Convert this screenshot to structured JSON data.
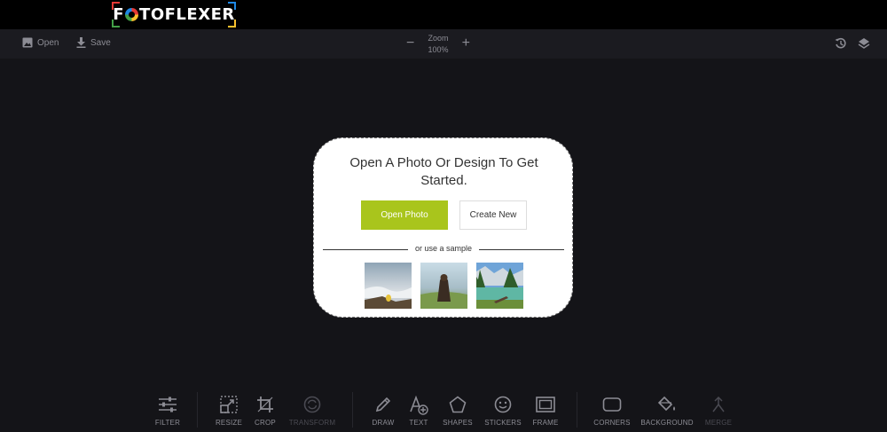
{
  "brand": {
    "name_prefix": "F",
    "name_suffix": "TOFLEXER"
  },
  "toolbar": {
    "open_label": "Open",
    "save_label": "Save",
    "zoom_label": "Zoom",
    "zoom_value": "100%",
    "zoom_minus": "−",
    "zoom_plus": "+"
  },
  "card": {
    "title": "Open A Photo Or Design To Get Started.",
    "open_photo_label": "Open Photo",
    "create_new_label": "Create New",
    "sample_label": "or use a sample",
    "samples": [
      "sample-fog-mountain",
      "sample-woman-hill",
      "sample-lake-forest"
    ]
  },
  "tools": [
    {
      "label": "FILTER",
      "icon": "sliders-icon",
      "enabled": true
    },
    {
      "label": "RESIZE",
      "icon": "resize-icon",
      "enabled": true
    },
    {
      "label": "CROP",
      "icon": "crop-icon",
      "enabled": true
    },
    {
      "label": "TRANSFORM",
      "icon": "transform-icon",
      "enabled": false
    },
    {
      "label": "DRAW",
      "icon": "pencil-icon",
      "enabled": true
    },
    {
      "label": "TEXT",
      "icon": "text-add-icon",
      "enabled": true
    },
    {
      "label": "SHAPES",
      "icon": "pentagon-icon",
      "enabled": true
    },
    {
      "label": "STICKERS",
      "icon": "smiley-icon",
      "enabled": true
    },
    {
      "label": "FRAME",
      "icon": "frame-icon",
      "enabled": true
    },
    {
      "label": "CORNERS",
      "icon": "rounded-rect-icon",
      "enabled": true
    },
    {
      "label": "BACKGROUND",
      "icon": "paint-bucket-icon",
      "enabled": true
    },
    {
      "label": "MERGE",
      "icon": "merge-icon",
      "enabled": false
    }
  ],
  "colors": {
    "accent": "#a9c51c",
    "background": "#141418",
    "toolbar": "#1b1b20",
    "icon": "#8c8c94"
  }
}
